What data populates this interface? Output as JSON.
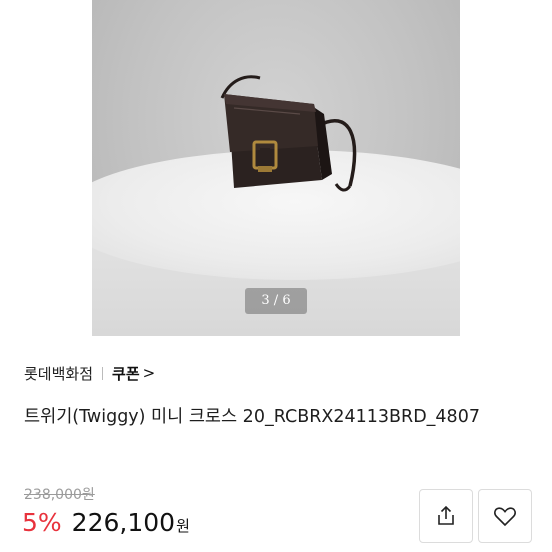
{
  "gallery": {
    "page_indicator": "3 / 6",
    "image_alt": "bag-photo"
  },
  "seller": {
    "name": "롯데백화점",
    "coupon_label": "쿠폰",
    "chevron": ">"
  },
  "product": {
    "title": "트위기(Twiggy) 미니 크로스 20_RCBRX24113BRD_4807"
  },
  "pricing": {
    "original_price": "238,000원",
    "discount_rate": "5%",
    "sale_price": "226,100",
    "currency": "원"
  },
  "actions": {
    "share_icon": "share-icon",
    "wish_icon": "heart-icon"
  },
  "colors": {
    "discount": "#e8323c",
    "bag": "#2b2220",
    "buckle": "#b08a3e"
  }
}
